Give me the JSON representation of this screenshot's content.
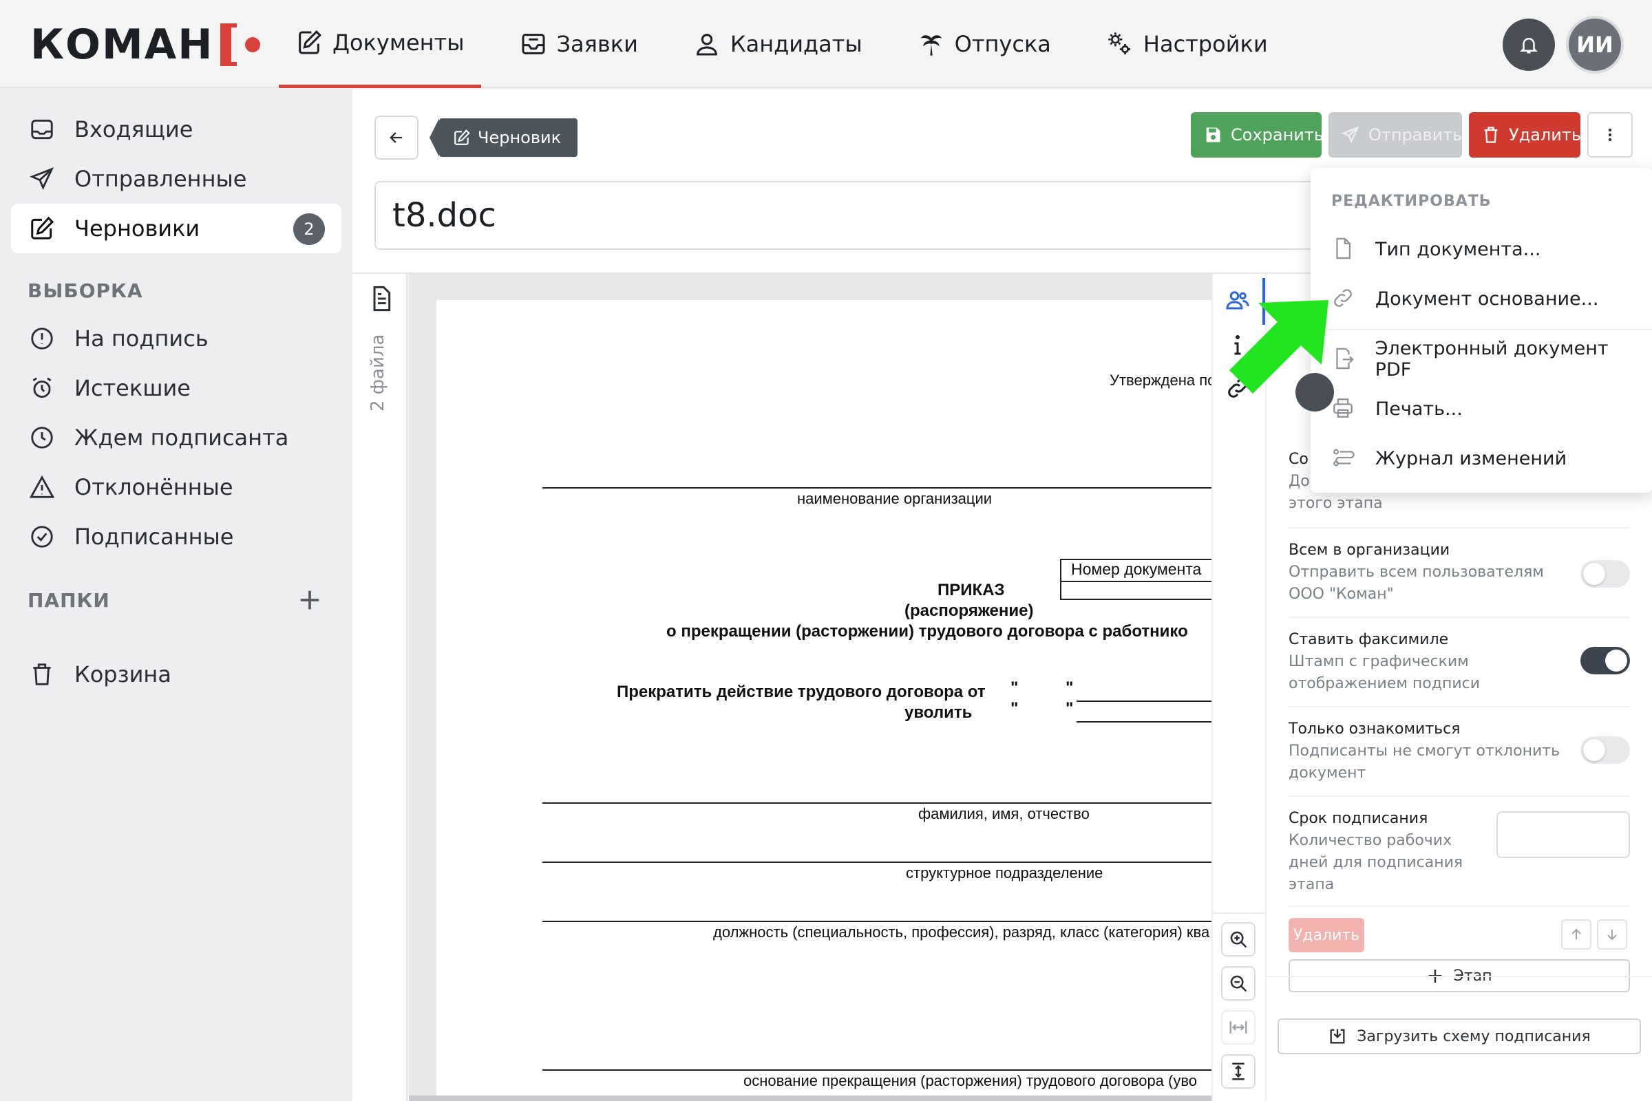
{
  "app": {
    "logo_text": "КОМАН",
    "nav": [
      {
        "label": "Документы",
        "icon": "document-edit-icon"
      },
      {
        "label": "Заявки",
        "icon": "inbox-tray-icon"
      },
      {
        "label": "Кандидаты",
        "icon": "person-badge-icon"
      },
      {
        "label": "Отпуска",
        "icon": "palm-tree-icon"
      },
      {
        "label": "Настройки",
        "icon": "gears-icon"
      }
    ],
    "active_nav": "Документы",
    "avatar_initials": "ИИ"
  },
  "sidebar": {
    "items": [
      {
        "label": "Входящие",
        "icon": "inbox-icon"
      },
      {
        "label": "Отправленные",
        "icon": "paper-plane-icon"
      },
      {
        "label": "Черновики",
        "icon": "pencil-square-icon",
        "badge": "2",
        "active": true
      }
    ],
    "selection_heading": "ВЫБОРКА",
    "selection_items": [
      {
        "label": "На подпись",
        "icon": "exclamation-circle-icon"
      },
      {
        "label": "Истекшие",
        "icon": "alarm-clock-icon"
      },
      {
        "label": "Ждем подписанта",
        "icon": "clock-icon"
      },
      {
        "label": "Отклонённые",
        "icon": "warning-triangle-icon"
      },
      {
        "label": "Подписанные",
        "icon": "check-circle-icon"
      }
    ],
    "folders_heading": "ПАПКИ",
    "trash_label": "Корзина"
  },
  "document": {
    "status_tag": "Черновик",
    "title": "t8.doc",
    "files_label": "2 файла",
    "save_label": "Сохранить",
    "send_label": "Отправить",
    "delete_label": "Удалить"
  },
  "doc_preview": {
    "approved": "Утверждена по",
    "org_caption": "наименование организации",
    "docnum_caption": "Номер документа",
    "order_title": "ПРИКАЗ",
    "order_sub": "(распоряжение)",
    "order_about": "о прекращении (расторжении) трудового договора с работнико",
    "terminate": "Прекратить действие трудового договора от",
    "dismiss": "уволить",
    "quote": "\"",
    "fio_caption": "фамилия, имя, отчество",
    "dept_caption": "структурное подразделение",
    "position_caption": "должность (специальность, профессия), разряд, класс (категория) ква",
    "basis_caption": "основание прекращения (расторжения) трудового договора (уво"
  },
  "menu": {
    "heading": "РЕДАКТИРОВАТЬ",
    "items": [
      {
        "label": "Тип документа...",
        "icon": "file-icon"
      },
      {
        "label": "Документ основание...",
        "icon": "link-icon"
      },
      {
        "label": "Электронный документ PDF",
        "icon": "file-export-icon"
      },
      {
        "label": "Печать...",
        "icon": "printer-icon"
      },
      {
        "label": "Журнал изменений",
        "icon": "history-log-icon"
      }
    ]
  },
  "settings": {
    "partial_title": "Со",
    "partial_desc_1": "До",
    "partial_desc_2": "этого этапа",
    "rows": [
      {
        "title": "Всем в организации",
        "desc": "Отправить всем пользователям ООО \"Коман\"",
        "on": false
      },
      {
        "title": "Ставить факсимиле",
        "desc": "Штамп с графическим отображением подписи",
        "on": true
      },
      {
        "title": "Только ознакомиться",
        "desc": "Подписанты не смогут отклонить документ",
        "on": false
      }
    ],
    "deadline_title": "Срок подписания",
    "deadline_desc": "Количество рабочих дней для подписания этапа",
    "stage_delete_label": "Удалить",
    "add_stage_label": "Этап",
    "upload_scheme_label": "Загрузить схему подписания"
  },
  "colors": {
    "accent": "#d8403a",
    "save": "#4fa35a",
    "delete": "#cf3a31",
    "annotation_arrow": "#22e51f"
  }
}
